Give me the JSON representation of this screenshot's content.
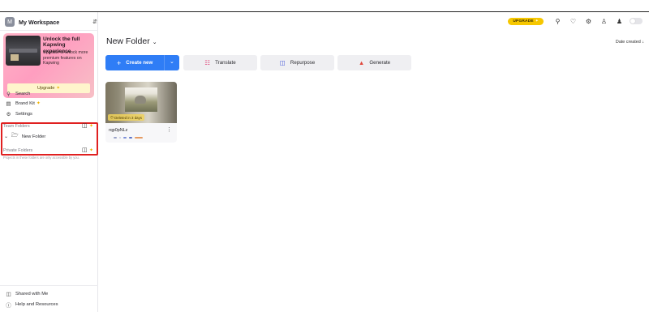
{
  "workspace": {
    "avatar_letter": "M",
    "name": "My Workspace"
  },
  "promo": {
    "title": "Unlock the full Kapwing experience",
    "text": "Upgrade to unlock more premium features on Kapwing",
    "button_label": "Upgrade"
  },
  "nav": {
    "search": "Search",
    "brand_kit": "Brand Kit",
    "settings": "Settings"
  },
  "team_folders": {
    "label": "Team Folders",
    "folders": [
      "New Folder"
    ]
  },
  "private_folders": {
    "label": "Private Folders",
    "note": "Projects in these folders are only accessible by you."
  },
  "sidebar_bottom": {
    "shared": "Shared with Me",
    "help": "Help and Resources"
  },
  "topbar": {
    "upgrade_label": "UPGRADE"
  },
  "main": {
    "title": "New Folder",
    "sort_label": "Date created",
    "create_label": "Create new",
    "actions": [
      {
        "label": "Translate",
        "icon": "translate-icon",
        "color": "#e14a7c"
      },
      {
        "label": "Repurpose",
        "icon": "repurpose-icon",
        "color": "#3a4fd8"
      },
      {
        "label": "Generate",
        "icon": "generate-icon",
        "color": "#e0473b"
      }
    ]
  },
  "card": {
    "name": "rqp0pNLz",
    "expire_text": "Deleted in 3 days",
    "meta_colors": [
      "#9aa2c8",
      "#c8cbe0",
      "#7d8fd9",
      "#5d73c8",
      "#e59b63"
    ]
  },
  "colors": {
    "accent": "#2f7df6",
    "upgrade": "#f6c700",
    "highlight_border": "#e02020"
  }
}
